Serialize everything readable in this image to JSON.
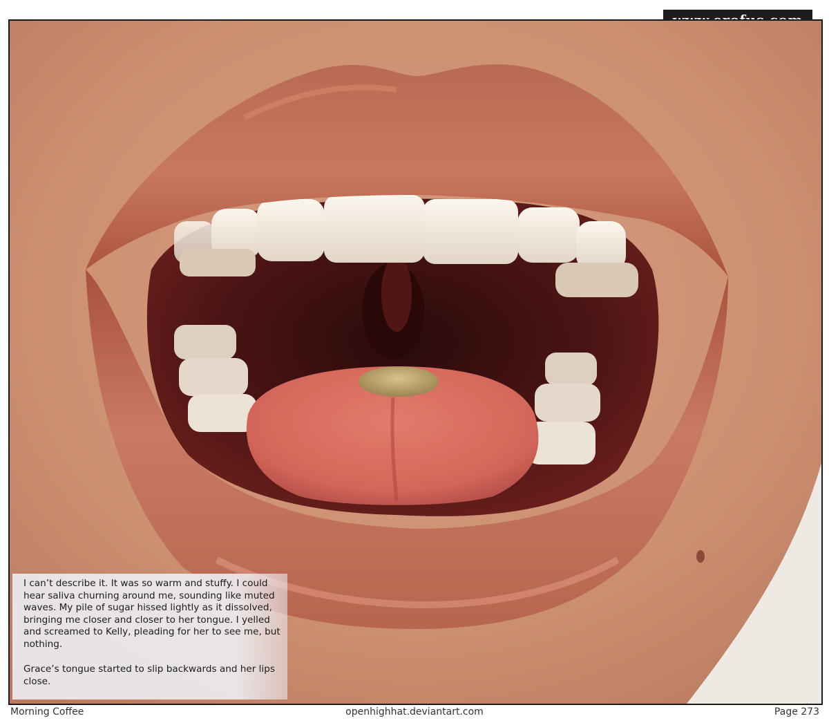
{
  "watermark": "www.erofus.com",
  "caption": {
    "paragraphs": [
      "I can’t describe it. It was so warm and stuffy. I could hear saliva churning around me, sounding like muted waves. My pile of sugar hissed lightly as it dissolved, bringing me closer and closer to her tongue. I yelled and screamed to Kelly, pleading for her to see me, but nothing.",
      "Grace’s tongue started to slip backwards and her lips close."
    ]
  },
  "footer": {
    "title": "Morning Coffee",
    "site": "openhighhat.deviantart.com",
    "page": "Page 273"
  },
  "colors": {
    "skin": "#cf9478",
    "lips": "#c06a56",
    "mouth_interior": "#3a0f10",
    "tongue": "#d8685c",
    "teeth": "#efe6da",
    "frame": "#1a1a1a",
    "caption_box": "#eef1f6"
  }
}
